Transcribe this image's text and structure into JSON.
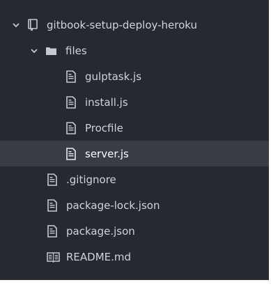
{
  "tree": {
    "root": {
      "label": "gitbook-setup-deploy-heroku",
      "icon": "repo-icon",
      "expanded": true
    },
    "folder": {
      "label": "files",
      "icon": "folder-icon",
      "expanded": true,
      "children": [
        {
          "label": "gulptask.js",
          "icon": "file-text-icon"
        },
        {
          "label": "install.js",
          "icon": "file-text-icon"
        },
        {
          "label": "Procfile",
          "icon": "file-text-icon"
        },
        {
          "label": "server.js",
          "icon": "file-text-icon",
          "selected": true
        }
      ]
    },
    "files": [
      {
        "label": ".gitignore",
        "icon": "file-text-icon"
      },
      {
        "label": "package-lock.json",
        "icon": "file-text-icon"
      },
      {
        "label": "package.json",
        "icon": "file-text-icon"
      },
      {
        "label": "README.md",
        "icon": "book-icon"
      }
    ]
  },
  "colors": {
    "background": "#262a30",
    "selected": "#373c45",
    "text": "#d0d4da"
  }
}
